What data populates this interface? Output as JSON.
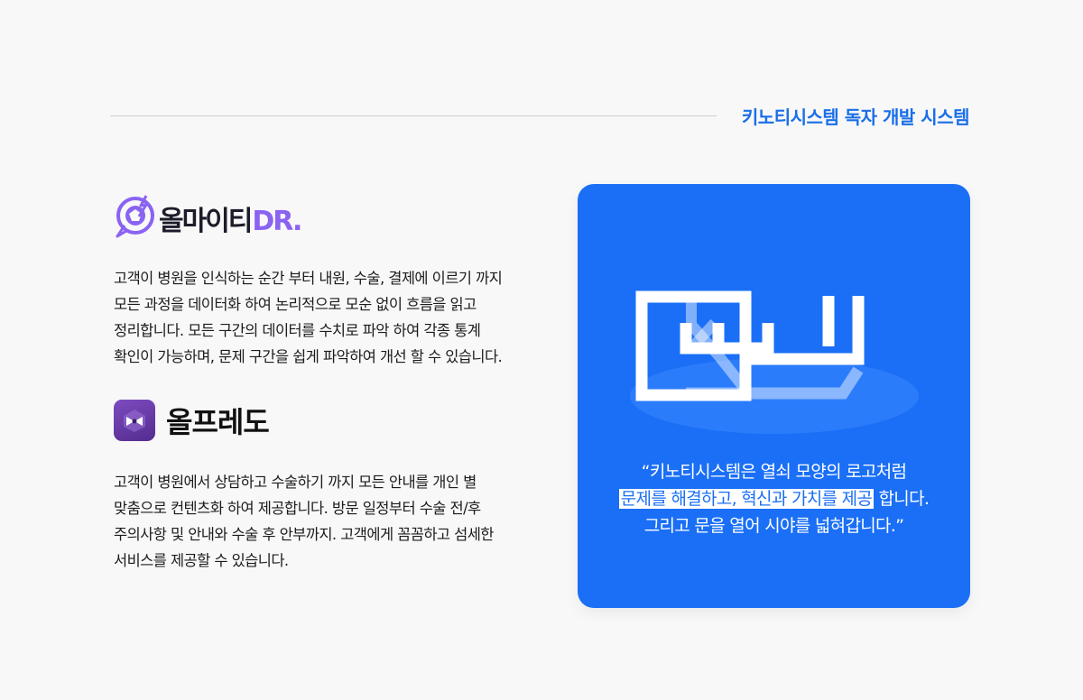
{
  "header": {
    "title": "키노티시스템 독자 개발 시스템"
  },
  "allmighty": {
    "logo_text": "올마이티",
    "logo_suffix": "DR.",
    "description": "고객이 병원을 인식하는 순간 부터 내원, 수술, 결제에 이르기 까지 모든 과정을 데이터화 하여 논리적으로 모순 없이 흐름을 읽고 정리합니다. 모든 구간의 데이터를 수치로 파악 하여 각종 통계 확인이 가능하며, 문제 구간을 쉽게 파악하여 개선 할 수 있습니다."
  },
  "alfredo": {
    "logo_text": "올프레도",
    "description": "고객이 병원에서 상담하고 수술하기 까지 모든 안내를 개인 별 맞춤으로 컨텐츠화 하여 제공합니다. 방문 일정부터 수술 전/후 주의사항 및 안내와 수술 후 안부까지. 고객에게 꼼꼼하고 섬세한 서비스를 제공할 수 있습니다."
  },
  "card": {
    "quote_line1": "“키노티시스템은 열쇠 모양의 로고처럼",
    "quote_highlight": "문제를 해결하고, 혁신과 가치를 제공",
    "quote_line2_rest": " 합니다.",
    "quote_line3": "그리고 문을 열어 시야를 넓혀갑니다.”"
  },
  "colors": {
    "accent": "#1a6ff6",
    "header_accent": "#1a6fe8",
    "allmighty_purple": "#8a63f2",
    "alfredo_purple": "#6a3aa8",
    "background": "#f8f8f8"
  }
}
